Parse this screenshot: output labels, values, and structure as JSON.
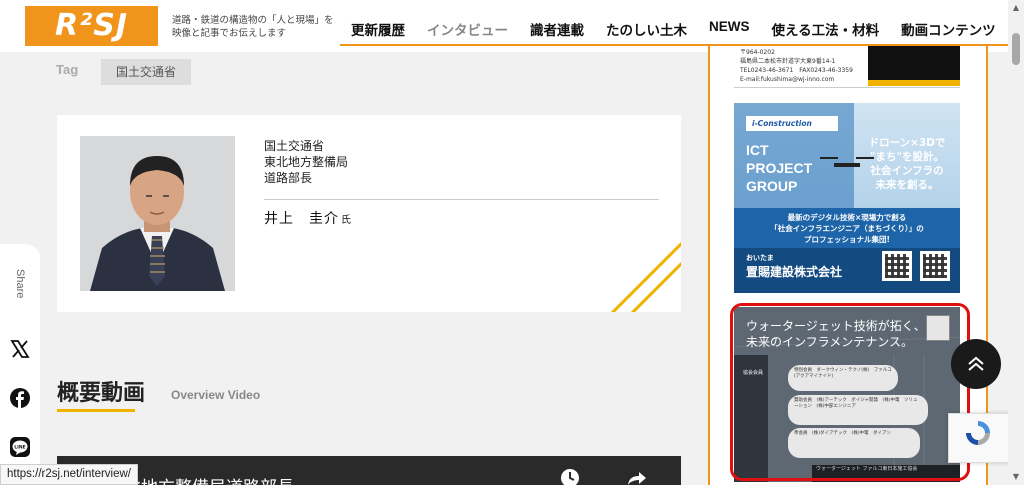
{
  "header": {
    "logo_text": "R²SJ",
    "tagline": "道路・鉄道の構造物の「人と現場」を映像と記事でお伝えします",
    "nav": [
      {
        "label": "更新履歴"
      },
      {
        "label": "インタビュー"
      },
      {
        "label": "識者連載"
      },
      {
        "label": "たのしい土木"
      },
      {
        "label": "NEWS"
      },
      {
        "label": "使える工法・材料"
      },
      {
        "label": "動画コンテンツ"
      }
    ],
    "active_nav": "インタビュー"
  },
  "tag": {
    "label": "Tag",
    "chip": "国土交通省"
  },
  "profile": {
    "line1": "国土交通省",
    "line2": "東北地方整備局",
    "line3": "道路部長",
    "name": "井上　圭介",
    "honorific": "氏"
  },
  "share": {
    "label": "Share",
    "icons": [
      "x-icon",
      "facebook-icon",
      "line-icon"
    ]
  },
  "overview": {
    "title": "概要動画",
    "subtitle": "Overview Video",
    "video_title": "東北地方整備局道路部長"
  },
  "status_url": "https://r2sj.net/interview/",
  "sidebar": {
    "ad1": {
      "lines": [
        "〒964-0202",
        "福島県二本松市針道字大東9番14-1",
        "TEL0243-46-3671　FAX0243-46-3359",
        "E-mail:fukushima@wj-inno.com"
      ]
    },
    "ad2": {
      "logo": "i-Construction",
      "ict_lines": [
        "ICT",
        "PROJECT",
        "GROUP"
      ],
      "right_lines": [
        "ドローン×3Dで",
        "\"まち\"を設計。",
        "社会インフラの",
        "未来を創る。"
      ],
      "desc_lines": [
        "最新のデジタル技術×現場力で創る",
        "「社会インフラエンジニア（まちづくり）」の",
        "プロフェッショナル集団!"
      ],
      "location": "おいたま",
      "company": "置賜建設株式会社"
    },
    "ad3": {
      "headline_lines": [
        "ウォータージェット技術が拓く、",
        "未来のインフラメンテナンス。"
      ],
      "member_label": "協会会員",
      "pills": [
        "特別会員　ダークウィン・テクノ(株)　ファルコ(アクアマイナイド)",
        "賛助会員　(株)アーテック　ボイジャ開発　(株)中電　ソリューション　(株)中部エンジニア",
        "準会員　(株)ダイアテック　(株)中電　ダイアン"
      ],
      "footer": "ウォータージェット ファルコ東日本施工協会"
    }
  },
  "colors": {
    "brand_orange": "#f0941c",
    "accent_yellow": "#f0b400",
    "highlight_red": "#e01010"
  }
}
